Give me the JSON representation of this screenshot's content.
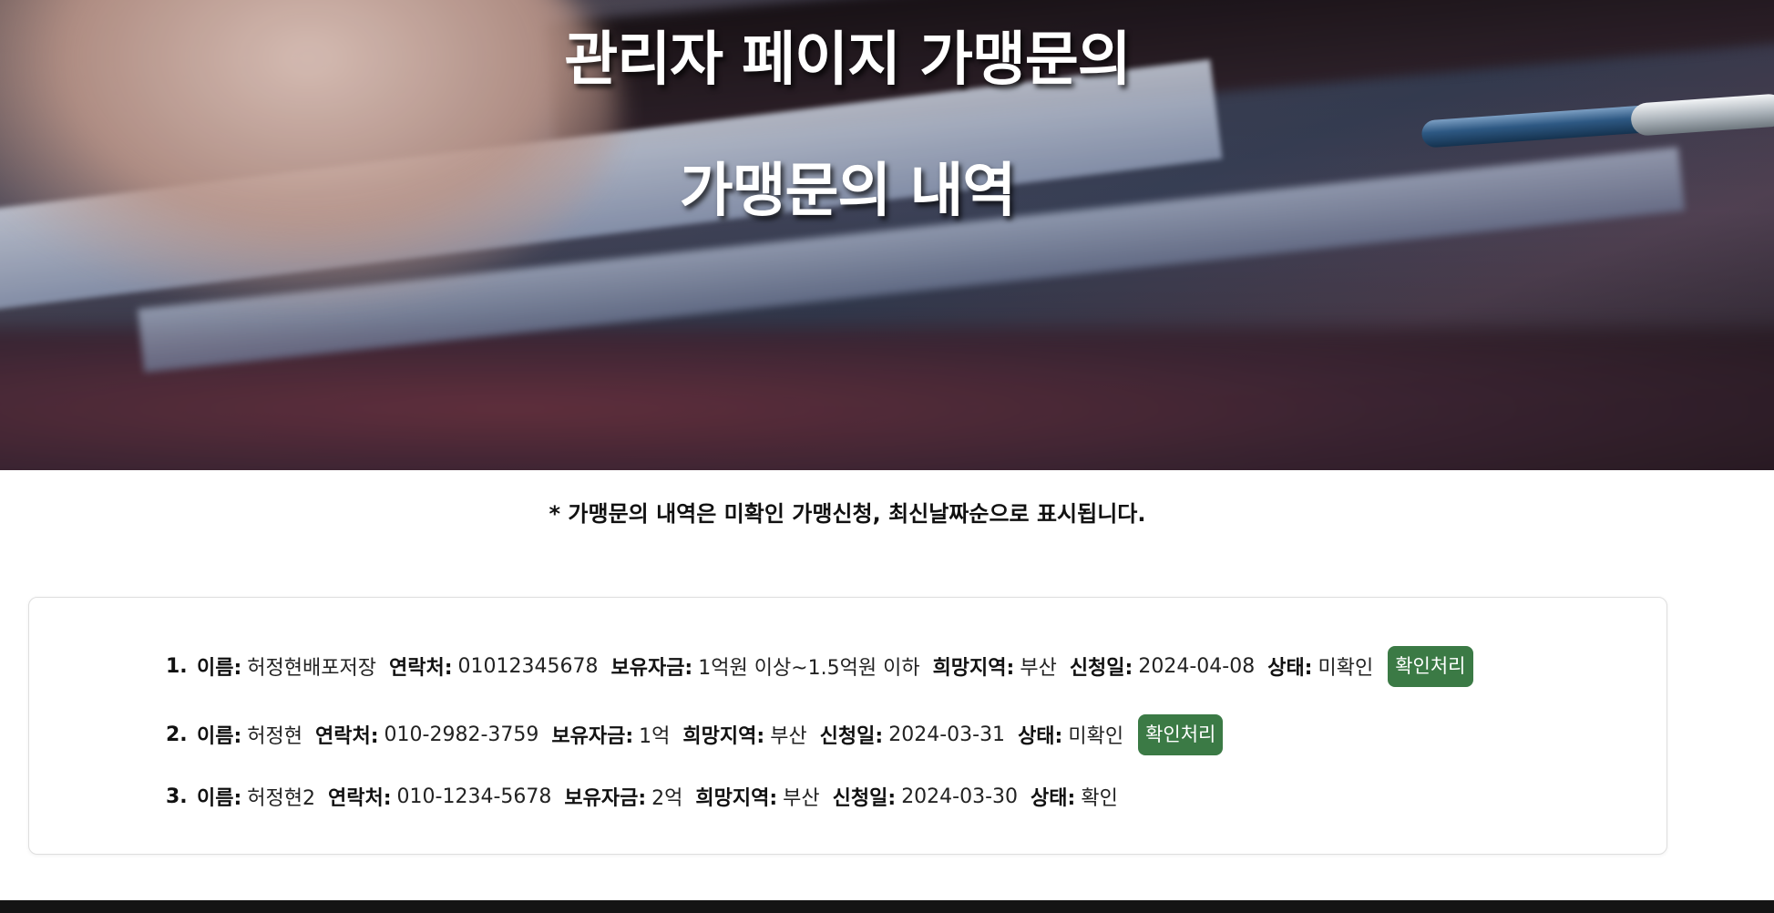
{
  "hero": {
    "title_line1": "관리자 페이지 가맹문의",
    "title_line2": "가맹문의 내역"
  },
  "notice": "* 가맹문의 내역은 미확인 가맹신청, 최신날짜순으로 표시됩니다.",
  "labels": {
    "name": "이름:",
    "contact": "연락처:",
    "funds": "보유자금:",
    "region": "희망지역:",
    "date": "신청일:",
    "status": "상태:"
  },
  "entries": [
    {
      "num": "1.",
      "name": "허정현배포저장",
      "contact": "01012345678",
      "funds": "1억원 이상~1.5억원 이하",
      "region": "부산",
      "date": "2024-04-08",
      "status": "미확인",
      "button": "확인처리"
    },
    {
      "num": "2.",
      "name": "허정현",
      "contact": "010-2982-3759",
      "funds": "1억",
      "region": "부산",
      "date": "2024-03-31",
      "status": "미확인",
      "button": "확인처리"
    },
    {
      "num": "3.",
      "name": "허정현2",
      "contact": "010-1234-5678",
      "funds": "2억",
      "region": "부산",
      "date": "2024-03-30",
      "status": "확인"
    }
  ],
  "colors": {
    "confirm_button": "#3b7a45",
    "footer": "#141414"
  }
}
